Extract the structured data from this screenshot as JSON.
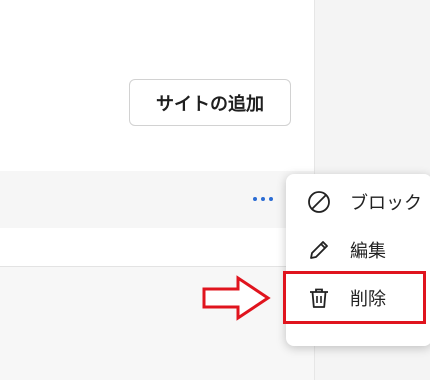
{
  "toolbar": {
    "add_site_label": "サイトの追加"
  },
  "row": {
    "more_icon": "more-horizontal-icon"
  },
  "menu": {
    "items": [
      {
        "label": "ブロック",
        "icon": "block-icon"
      },
      {
        "label": "編集",
        "icon": "pencil-icon"
      },
      {
        "label": "削除",
        "icon": "trash-icon"
      }
    ]
  },
  "colors": {
    "accent": "#2b6cd4",
    "annotation": "#e0141e"
  }
}
